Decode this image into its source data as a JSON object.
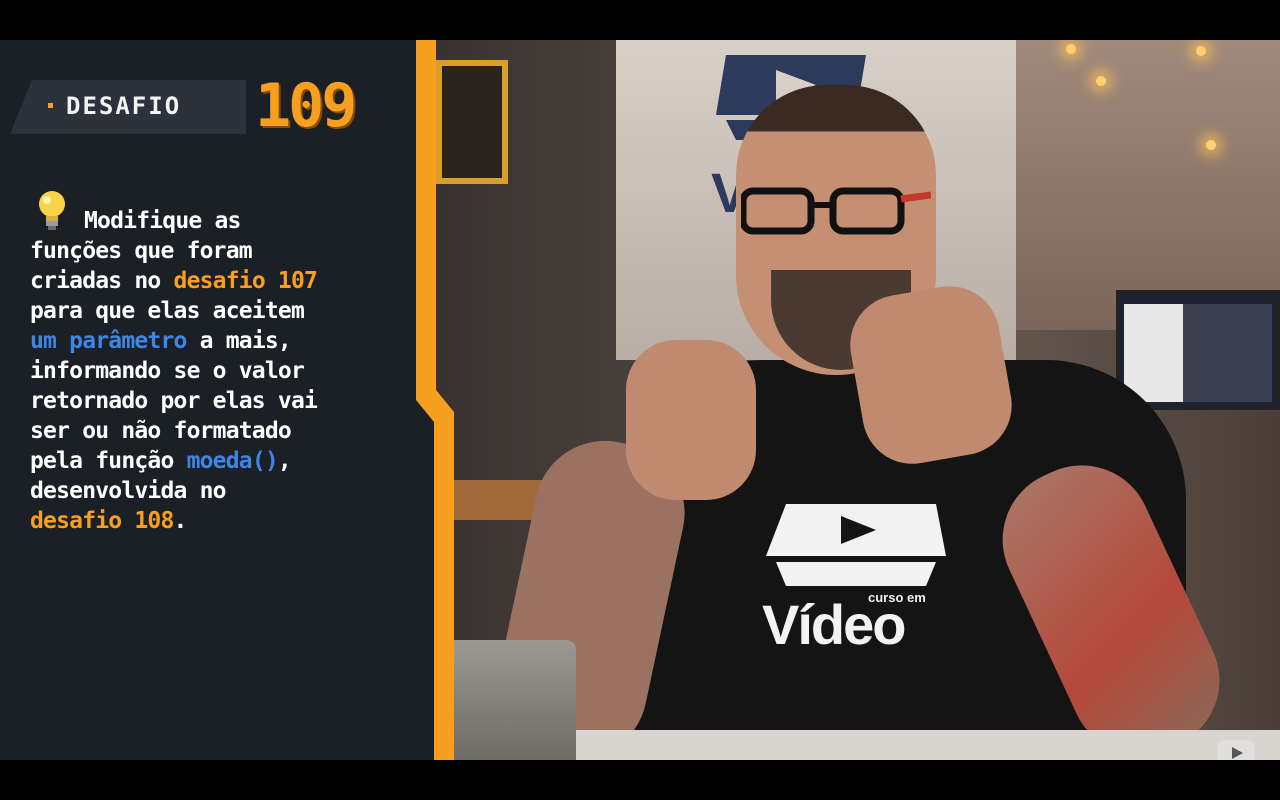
{
  "video": {
    "wall_logo_text": "Víd",
    "shirt_small_text": "curso em",
    "shirt_text": "Vídeo"
  },
  "badge": {
    "label": "DESAFIO",
    "number": "109"
  },
  "challenge": {
    "lines": [
      "Modifique as",
      "funções que foram",
      "criadas no ",
      "desafio 107",
      "para que elas aceitem",
      "um parâmetro",
      " a mais,",
      "informando se o valor",
      "retornado por elas vai",
      "ser ou não formatado",
      "pela função ",
      "moeda()",
      ",",
      "desenvolvida no",
      "desafio 108",
      "."
    ]
  },
  "colors": {
    "accent_orange": "#f7a020",
    "accent_blue": "#3e86e6",
    "panel_bg": "#1b1f26",
    "badge_bg": "#2c323c"
  },
  "icons": {
    "bulb": "lightbulb-icon",
    "play_logo": "play-logo-icon",
    "youtube": "youtube-logo-icon"
  }
}
